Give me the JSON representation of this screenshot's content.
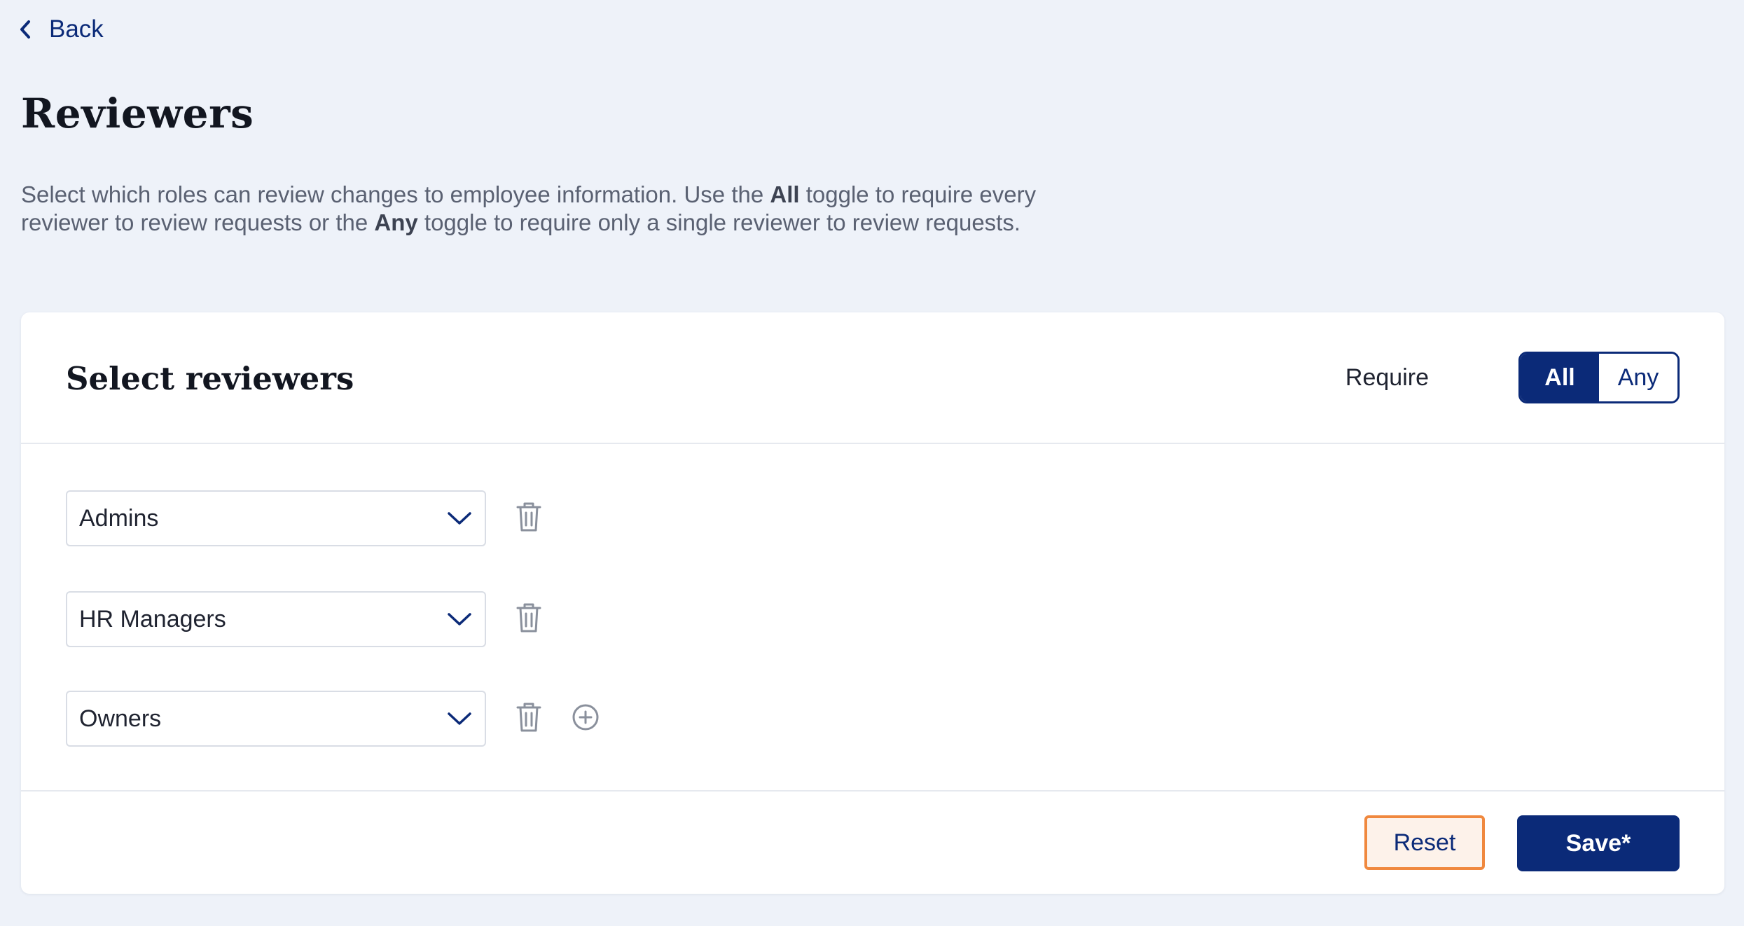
{
  "nav": {
    "back_label": "Back"
  },
  "page": {
    "title": "Reviewers",
    "description": {
      "part1": "Select which roles can review changes to employee information. Use the ",
      "bold1": "All",
      "part2": " toggle to require every reviewer to review requests or the ",
      "bold2": "Any",
      "part3": " toggle to require only a single reviewer to review requests."
    }
  },
  "card": {
    "title": "Select reviewers",
    "require_label": "Require",
    "toggle": {
      "options": [
        "All",
        "Any"
      ],
      "selected": "All"
    },
    "reviewers": [
      {
        "role": "Admins"
      },
      {
        "role": "HR Managers"
      },
      {
        "role": "Owners"
      }
    ],
    "icons": {
      "dropdown": "chevron-down-icon",
      "delete": "trash-icon",
      "add": "plus-circle-icon",
      "back": "chevron-left-icon"
    },
    "footer": {
      "reset_label": "Reset",
      "save_label": "Save*"
    }
  },
  "colors": {
    "brand": "#0b2a78",
    "background": "#eef2f9",
    "focus_outline": "#f0883e",
    "icon_gray": "#8a909c"
  }
}
